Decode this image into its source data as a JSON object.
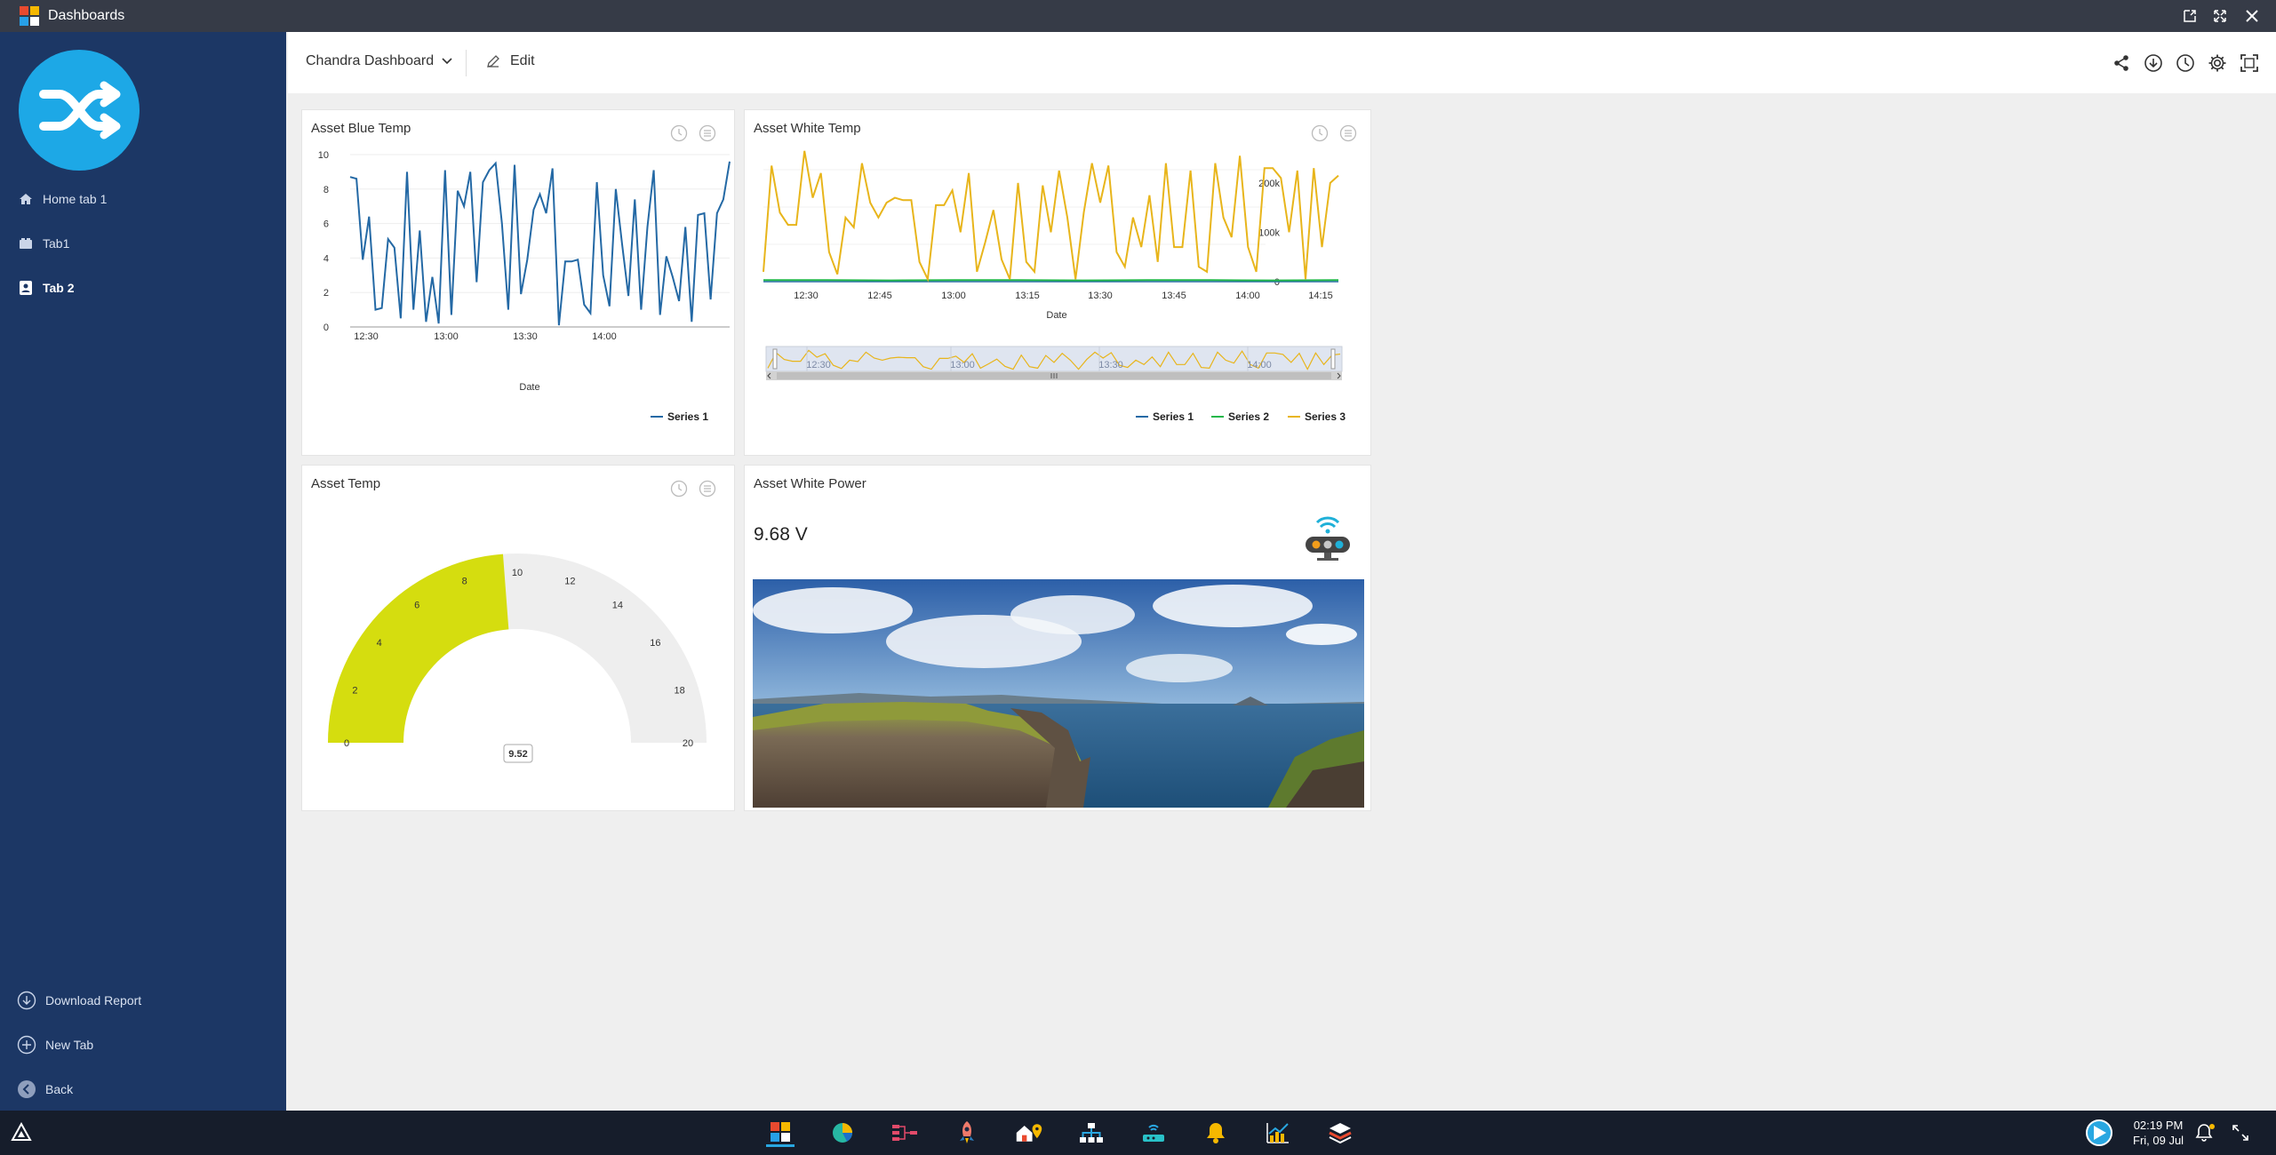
{
  "window": {
    "title": "Dashboards"
  },
  "sidebar": {
    "items": [
      {
        "label": "Home tab 1",
        "icon": "home-icon",
        "active": false
      },
      {
        "label": "Tab1",
        "icon": "tab-icon",
        "active": false
      },
      {
        "label": "Tab 2",
        "icon": "contact-card-icon",
        "active": true
      }
    ],
    "bottom": [
      {
        "label": "Download Report",
        "icon": "download-circle-icon"
      },
      {
        "label": "New Tab",
        "icon": "plus-circle-icon"
      },
      {
        "label": "Back",
        "icon": "back-circle-icon"
      }
    ]
  },
  "header": {
    "dashboard_name": "Chandra Dashboard",
    "edit_label": "Edit",
    "icons": [
      "share-icon",
      "download-icon",
      "history-icon",
      "settings-icon",
      "fullscreen-icon"
    ]
  },
  "widgets": {
    "blue_temp": {
      "title": "Asset Blue Temp",
      "xlabel": "Date",
      "legend": "Series 1"
    },
    "white_temp": {
      "title": "Asset White Temp",
      "xlabel": "Date",
      "legend": [
        "Series 1",
        "Series 2",
        "Series 3"
      ]
    },
    "temp": {
      "title": "Asset Temp",
      "value": "9.52"
    },
    "white_power": {
      "title": "Asset White Power",
      "value": "9.68 V"
    }
  },
  "chart_data": [
    {
      "type": "line",
      "title": "Asset Blue Temp",
      "xlabel": "Date",
      "ylim": [
        0,
        10
      ],
      "yticks": [
        "0",
        "2",
        "4",
        "6",
        "8",
        "10"
      ],
      "xticks": [
        "12:30",
        "13:00",
        "13:30",
        "14:00"
      ],
      "series": [
        {
          "name": "Series 1",
          "color": "#2469a5",
          "values": [
            8.7,
            8.6,
            3.9,
            6.4,
            1.0,
            1.1,
            5.1,
            4.6,
            0.5,
            9.0,
            1.0,
            5.6,
            0.3,
            2.9,
            0.2,
            9.1,
            0.7,
            7.9,
            7.0,
            9.0,
            2.6,
            8.4,
            9.1,
            9.5,
            6.0,
            1.0,
            9.4,
            1.9,
            3.9,
            6.8,
            7.7,
            6.6,
            9.2,
            0.1,
            3.8,
            3.8,
            3.9,
            1.3,
            0.8,
            8.4,
            3.0,
            1.2,
            8.0,
            4.8,
            1.8,
            7.4,
            1.0,
            5.8,
            9.1,
            0.7,
            4.1,
            2.9,
            1.5,
            5.8,
            0.3,
            6.5,
            6.6,
            1.6,
            6.6,
            7.4,
            9.6
          ]
        }
      ]
    },
    {
      "type": "line",
      "title": "Asset White Temp",
      "xlabel": "Date",
      "yticks": [
        "0",
        "100k",
        "200k"
      ],
      "xticks": [
        "12:30",
        "12:45",
        "13:00",
        "13:15",
        "13:30",
        "13:45",
        "14:00",
        "14:15"
      ],
      "series": [
        {
          "name": "Series 1",
          "color": "#2469a5",
          "values": [
            0,
            0,
            0,
            0,
            0,
            0,
            0,
            0,
            0,
            0
          ]
        },
        {
          "name": "Series 2",
          "color": "#21b74a",
          "values": [
            3000,
            3000,
            2500,
            3000,
            3000,
            2500,
            3000,
            3000,
            2500,
            3000
          ]
        },
        {
          "name": "Series 3",
          "color": "#e8b51b",
          "values": [
            20000,
            235000,
            140000,
            115000,
            115000,
            265000,
            170000,
            220000,
            60000,
            15000,
            130000,
            110000,
            240000,
            160000,
            130000,
            160000,
            170000,
            165000,
            165000,
            40000,
            5000,
            155000,
            155000,
            185000,
            100000,
            220000,
            20000,
            80000,
            145000,
            45000,
            5000,
            200000,
            40000,
            20000,
            195000,
            100000,
            225000,
            130000,
            5000,
            140000,
            240000,
            160000,
            235000,
            60000,
            30000,
            130000,
            70000,
            175000,
            40000,
            240000,
            70000,
            70000,
            225000,
            30000,
            20000,
            240000,
            130000,
            90000,
            255000,
            70000,
            20000,
            230000,
            230000,
            210000,
            100000,
            225000,
            5000,
            230000,
            70000,
            200000,
            215000
          ]
        }
      ]
    },
    {
      "type": "gauge",
      "title": "Asset Temp",
      "min": 0,
      "max": 20,
      "value": 9.52,
      "ticks": [
        "0",
        "2",
        "4",
        "6",
        "8",
        "10",
        "12",
        "14",
        "16",
        "18",
        "20"
      ],
      "fill_color": "#d5dd0f",
      "track_color": "#eeeeee"
    }
  ],
  "taskbar": {
    "time": "02:19 PM",
    "date": "Fri, 09 Jul",
    "apps": [
      "dashboards-icon",
      "analytics-pie-icon",
      "flow-icon",
      "rocket-icon",
      "asset-location-icon",
      "hierarchy-icon",
      "device-icon",
      "alerts-icon",
      "reports-icon",
      "layers-icon"
    ]
  }
}
